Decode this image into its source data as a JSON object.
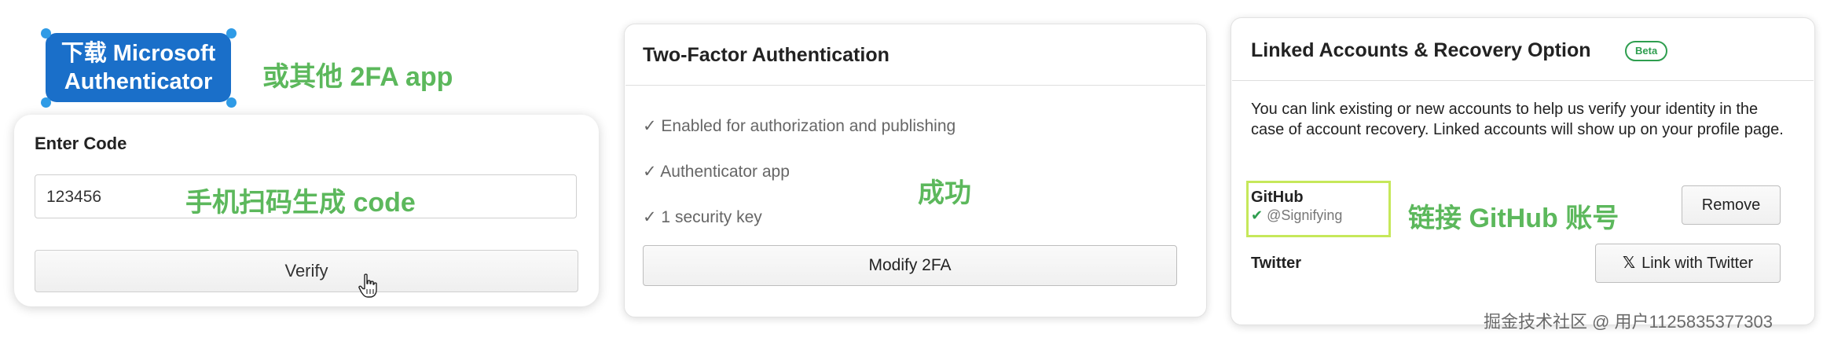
{
  "panel_download": {
    "badge_line1": "下载 Microsoft",
    "badge_line2": "Authenticator",
    "note": "或其他 2FA app",
    "badge_color": "#1a6fc9"
  },
  "panel_code": {
    "title": "Enter Code",
    "code_value": "123456",
    "note": "手机扫码生成 code",
    "verify_label": "Verify"
  },
  "panel_2fa": {
    "title": "Two-Factor Authentication",
    "checks": [
      "✓ Enabled for authorization and publishing",
      "✓ Authenticator app",
      "✓ 1 security key"
    ],
    "note": "成功",
    "modify_label": "Modify 2FA"
  },
  "panel_linked": {
    "title": "Linked Accounts & Recovery Option",
    "beta": "Beta",
    "description": "You can link existing or new accounts to help us verify your identity in the case of account recovery. Linked accounts will show up on your profile page.",
    "github_label": "GitHub",
    "github_check": "✔",
    "github_handle": "@Signifying",
    "note": "链接 GitHub 账号",
    "remove_label": "Remove",
    "twitter_label": "Twitter",
    "twitter_icon": "𝕏",
    "twitter_button": "Link with Twitter"
  },
  "watermark": "掘金技术社区 @ 用户1125835377303",
  "colors": {
    "note_green": "#5cb85c",
    "highlight_box": "#c6e85a",
    "check_green": "#2e9e4f"
  }
}
